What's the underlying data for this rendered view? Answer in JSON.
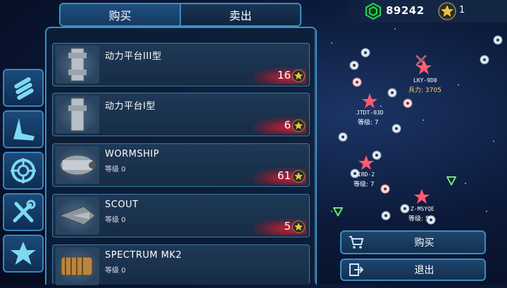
{
  "header": {
    "currency_value": "89242",
    "star_count": "1"
  },
  "tabs": [
    {
      "label": "购买",
      "active": true
    },
    {
      "label": "卖出",
      "active": false
    }
  ],
  "side_categories": [
    {
      "icon": "missiles-icon"
    },
    {
      "icon": "wing-icon"
    },
    {
      "icon": "crosshair-icon"
    },
    {
      "icon": "tools-icon"
    },
    {
      "icon": "star-icon"
    }
  ],
  "items": [
    {
      "name": "动力平台III型",
      "level": "",
      "price": "16",
      "icon": "platform-module-icon"
    },
    {
      "name": "动力平台I型",
      "level": "",
      "price": "6",
      "icon": "platform-module-icon"
    },
    {
      "name": "WORMSHIP",
      "level": "等级 0",
      "price": "61",
      "icon": "wormship-icon"
    },
    {
      "name": "SCOUT",
      "level": "等级 0",
      "price": "5",
      "icon": "scout-ship-icon"
    },
    {
      "name": "SPECTRUM MK2",
      "level": "等级 0",
      "price": "",
      "icon": "spectrum-ship-icon"
    }
  ],
  "map_markers": [
    {
      "name": "LKY-9D0",
      "sub": "兵力: 3705"
    },
    {
      "name": "JTDT-03D",
      "sub": "等级: 7"
    },
    {
      "name": "IRD-2",
      "sub": "等级: 7"
    },
    {
      "name": "Z-MSYQE",
      "sub": "等级: 5"
    }
  ],
  "actions": {
    "buy_label": "购买",
    "exit_label": "退出"
  },
  "colors": {
    "accent": "#3d8fbf",
    "price_glow": "#e01e32",
    "enemy_star": "#ff5a6e",
    "credit": "#27d35a",
    "gold": "#e8c23a"
  }
}
